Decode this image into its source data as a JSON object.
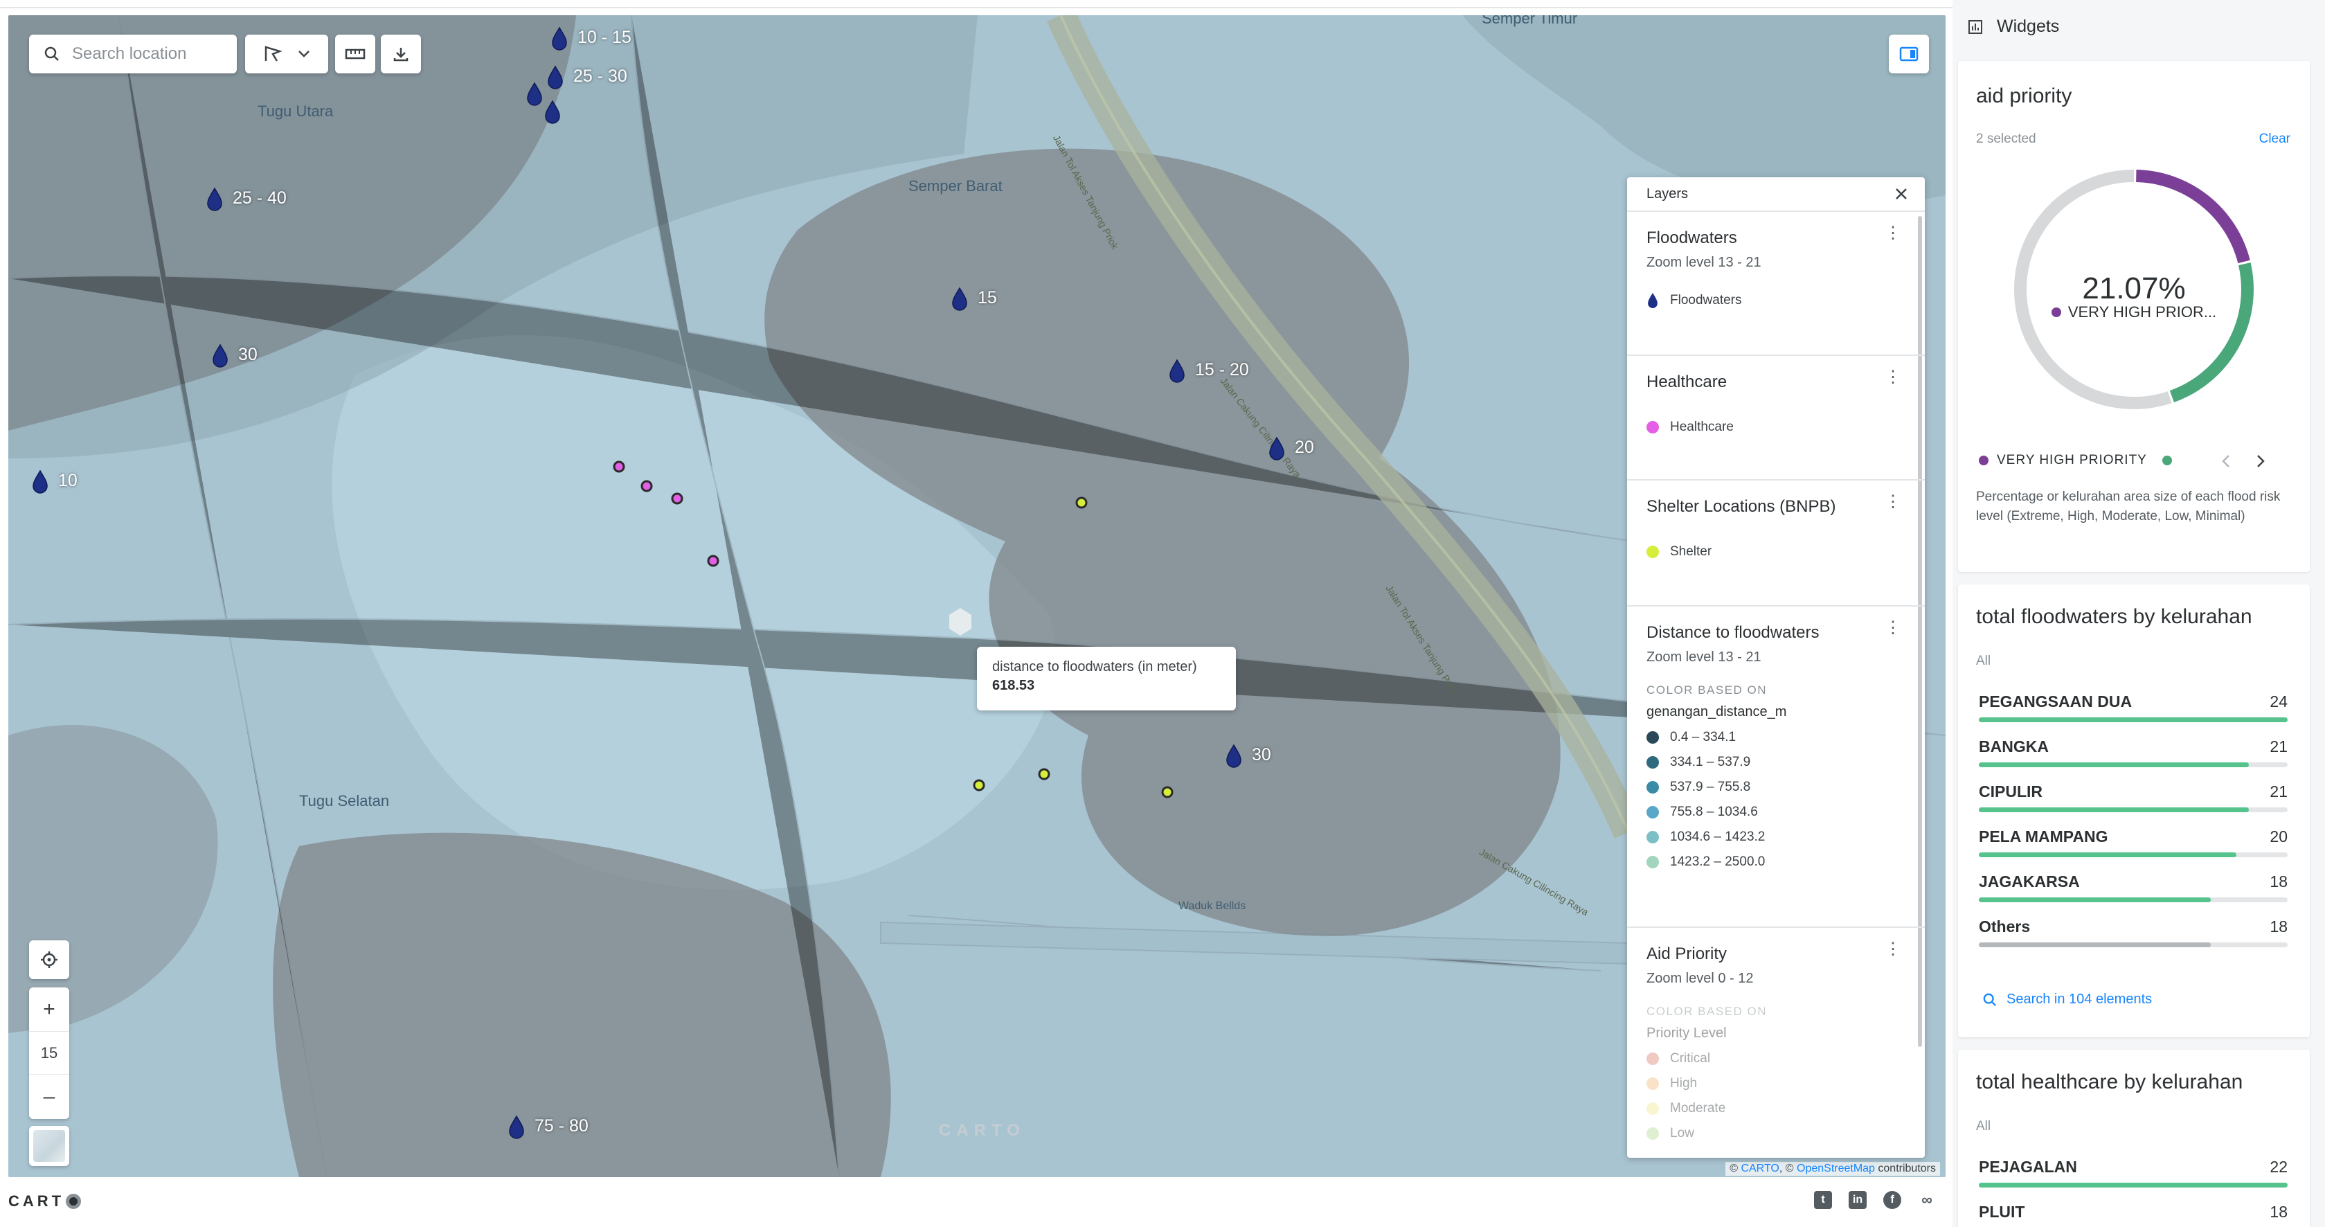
{
  "map": {
    "search_placeholder": "Search location",
    "zoom_level": "15",
    "zoom_in": "+",
    "zoom_out": "–",
    "watermark": "CARTO",
    "places": [
      "Semper Timur",
      "Tugu Utara",
      "Semper Barat",
      "Tugu Selatan",
      "Waduk Bellds"
    ],
    "roads": [
      "Jalan Tol Akses Tanjung Priok",
      "Jalan Cakung Cilincing Raya",
      "Jalan Tol Akses Tanjung Priok",
      "Jalan Cakung Cilincing Raya"
    ],
    "pin_labels": [
      "10 - 15",
      "25 - 30",
      "25 - 40",
      "30",
      "10",
      "15",
      "15 - 20",
      "20",
      "30",
      "75 - 80"
    ],
    "tooltip": {
      "label": "distance to floodwaters (in meter)",
      "value": "618.53"
    },
    "attribution": {
      "prefix": "© ",
      "carto": "CARTO",
      "sep": ", © ",
      "osm": "OpenStreetMap",
      "suffix": " contributors"
    }
  },
  "layers_panel": {
    "title": "Layers",
    "floodwaters": {
      "title": "Floodwaters",
      "zoom": "Zoom level 13 - 21",
      "legend": "Floodwaters",
      "color": "#1f3a93"
    },
    "healthcare": {
      "title": "Healthcare",
      "legend": "Healthcare",
      "color": "#e25fe6"
    },
    "shelter": {
      "title": "Shelter Locations (BNPB)",
      "legend": "Shelter",
      "color": "#d4ee3b"
    },
    "distance": {
      "title": "Distance to floodwaters",
      "zoom": "Zoom level 13 - 21",
      "color_based_on": "COLOR BASED ON",
      "field": "genangan_distance_m",
      "bins": [
        {
          "label": "0.4 – 334.1",
          "color": "#2a4858"
        },
        {
          "label": "334.1 – 537.9",
          "color": "#2f6a7f"
        },
        {
          "label": "537.9 – 755.8",
          "color": "#3b8aa6"
        },
        {
          "label": "755.8 – 1034.6",
          "color": "#5aa7c7"
        },
        {
          "label": "1034.6 – 1423.2",
          "color": "#7dbfc6"
        },
        {
          "label": "1423.2 – 2500.0",
          "color": "#a3d4be"
        }
      ]
    },
    "aid_priority": {
      "title": "Aid Priority",
      "zoom": "Zoom level 0 - 12",
      "color_based_on": "COLOR BASED ON",
      "field": "Priority Level",
      "bins": [
        {
          "label": "Critical",
          "color": "#f2b6ad"
        },
        {
          "label": "High",
          "color": "#f8d9b5"
        },
        {
          "label": "Moderate",
          "color": "#fdf5c9"
        },
        {
          "label": "Low",
          "color": "#d9ecc1"
        }
      ]
    }
  },
  "widgets": {
    "header": "Widgets",
    "aid_priority": {
      "title": "aid priority",
      "selected": "2 selected",
      "clear": "Clear",
      "center_value": "21.07%",
      "center_label": "VERY HIGH PRIOR...",
      "legend_label": "VERY HIGH PRIORITY",
      "description": "Percentage or kelurahan area size of each flood risk level (Extreme, High, Moderate, Low, Minimal)",
      "colors": {
        "very_high": "#7b3f97",
        "second": "#4aa77a",
        "other": "#d6d8da"
      }
    },
    "floodwaters": {
      "title": "total floodwaters by kelurahan",
      "filter": "All",
      "rows": [
        {
          "name": "PEGANGSAAN DUA",
          "value": 24
        },
        {
          "name": "BANGKA",
          "value": 21
        },
        {
          "name": "CIPULIR",
          "value": 21
        },
        {
          "name": "PELA MAMPANG",
          "value": 20
        },
        {
          "name": "JAGAKARSA",
          "value": 18
        },
        {
          "name": "Others",
          "value": 18
        }
      ],
      "search": "Search in 104 elements"
    },
    "healthcare": {
      "title": "total healthcare by kelurahan",
      "filter": "All",
      "rows": [
        {
          "name": "PEJAGALAN",
          "value": 22
        },
        {
          "name": "PLUIT",
          "value": 18
        }
      ]
    }
  },
  "chart_data": {
    "type": "pie",
    "title": "aid priority",
    "center_value": "21.07%",
    "center_label": "VERY HIGH PRIOR...",
    "slices": [
      {
        "label": "VERY HIGH PRIORITY",
        "value": 21.07,
        "color": "#7b3f97"
      },
      {
        "label": "",
        "value": 23.5,
        "color": "#4aa77a"
      },
      {
        "label": "",
        "value": 55.43,
        "color": "#d6d8da"
      }
    ]
  }
}
